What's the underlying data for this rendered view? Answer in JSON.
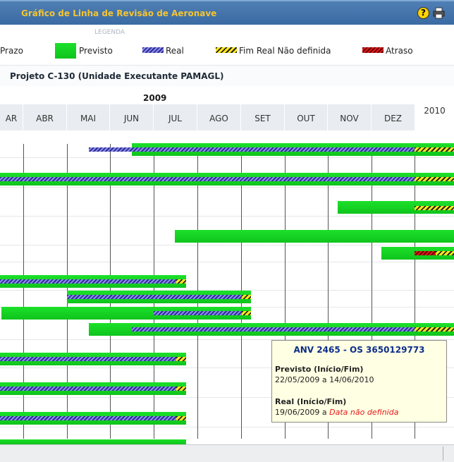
{
  "window": {
    "title": "Gráfico de Linha de Revisão de Aeronave",
    "help_icon": "help-icon",
    "print_icon": "printer-icon"
  },
  "legend": {
    "title": "LEGENDA",
    "items": [
      {
        "label": "Prazo",
        "swatch": "none"
      },
      {
        "label": "Previsto",
        "swatch": "green"
      },
      {
        "label": "Real",
        "swatch": "blue-hatch"
      },
      {
        "label": "Fim Real Não definida",
        "swatch": "yellow-hatch"
      },
      {
        "label": "Atraso",
        "swatch": "red-hatch"
      }
    ]
  },
  "project": {
    "title": "Projeto C-130 (Unidade Executante PAMAGL)"
  },
  "timeline": {
    "year_main": "2009",
    "year_next": "2010",
    "months": [
      "AR",
      "ABR",
      "MAI",
      "JUN",
      "JUL",
      "AGO",
      "SET",
      "OUT",
      "NOV",
      "DEZ"
    ]
  },
  "tooltip": {
    "title": "ANV 2465 - OS 3650129773",
    "previsto_label": "Previsto (Início/Fim)",
    "previsto_start": "22/05/2009",
    "previsto_sep": "a",
    "previsto_end": "14/06/2010",
    "real_label": "Real (Início/Fim)",
    "real_start": "19/06/2009",
    "real_sep": "a",
    "real_end": "Data não definida"
  },
  "colors": {
    "green": "#12d11f",
    "real": "#6f6fe0",
    "undefined_end": "#ffe81a",
    "delay": "#e21b1b",
    "header": "#3a6aa2",
    "title_text": "#f4c531"
  }
}
